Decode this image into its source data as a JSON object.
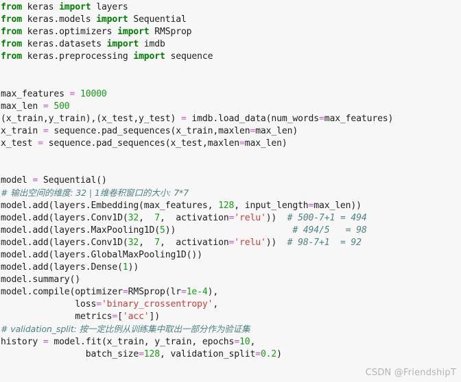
{
  "editor": {
    "background_color": "#f7f7f7",
    "default_text_color": "#202020",
    "syntax_colors": {
      "keyword": "#008000",
      "number": "#14a014",
      "string": "#d13b3b",
      "operator": "#cc55cc",
      "comment": "#4d8383"
    },
    "lines": [
      {
        "id": "l01",
        "tokens": [
          {
            "t": "from",
            "c": "kw"
          },
          {
            "t": " keras ",
            "c": "plain"
          },
          {
            "t": "import",
            "c": "kw"
          },
          {
            "t": " layers",
            "c": "plain"
          }
        ]
      },
      {
        "id": "l02",
        "tokens": [
          {
            "t": "from",
            "c": "kw"
          },
          {
            "t": " keras.models ",
            "c": "plain"
          },
          {
            "t": "import",
            "c": "kw"
          },
          {
            "t": " Sequential",
            "c": "plain"
          }
        ]
      },
      {
        "id": "l03",
        "tokens": [
          {
            "t": "from",
            "c": "kw"
          },
          {
            "t": " keras.optimizers ",
            "c": "plain"
          },
          {
            "t": "import",
            "c": "kw"
          },
          {
            "t": " RMSprop",
            "c": "plain"
          }
        ]
      },
      {
        "id": "l04",
        "tokens": [
          {
            "t": "from",
            "c": "kw"
          },
          {
            "t": " keras.datasets ",
            "c": "plain"
          },
          {
            "t": "import",
            "c": "kw"
          },
          {
            "t": " imdb",
            "c": "plain"
          }
        ]
      },
      {
        "id": "l05",
        "tokens": [
          {
            "t": "from",
            "c": "kw"
          },
          {
            "t": " keras.preprocessing ",
            "c": "plain"
          },
          {
            "t": "import",
            "c": "kw"
          },
          {
            "t": " sequence",
            "c": "plain"
          }
        ]
      },
      {
        "id": "l06",
        "tokens": []
      },
      {
        "id": "l07",
        "tokens": []
      },
      {
        "id": "l08",
        "tokens": [
          {
            "t": "max_features ",
            "c": "plain"
          },
          {
            "t": "=",
            "c": "op"
          },
          {
            "t": " ",
            "c": "plain"
          },
          {
            "t": "10000",
            "c": "num"
          }
        ]
      },
      {
        "id": "l09",
        "tokens": [
          {
            "t": "max_len ",
            "c": "plain"
          },
          {
            "t": "=",
            "c": "op"
          },
          {
            "t": " ",
            "c": "plain"
          },
          {
            "t": "500",
            "c": "num"
          }
        ]
      },
      {
        "id": "l10",
        "tokens": [
          {
            "t": "(x_train,y_train),(x_test,y_test) ",
            "c": "plain"
          },
          {
            "t": "=",
            "c": "op"
          },
          {
            "t": " imdb.load_data(num_words",
            "c": "plain"
          },
          {
            "t": "=",
            "c": "op"
          },
          {
            "t": "max_features)",
            "c": "plain"
          }
        ]
      },
      {
        "id": "l11",
        "tokens": [
          {
            "t": "x_train ",
            "c": "plain"
          },
          {
            "t": "=",
            "c": "op"
          },
          {
            "t": " sequence.pad_sequences(x_train,maxlen",
            "c": "plain"
          },
          {
            "t": "=",
            "c": "op"
          },
          {
            "t": "max_len)",
            "c": "plain"
          }
        ]
      },
      {
        "id": "l12",
        "tokens": [
          {
            "t": "x_test ",
            "c": "plain"
          },
          {
            "t": "=",
            "c": "op"
          },
          {
            "t": " sequence.pad_sequences(x_test,maxlen",
            "c": "plain"
          },
          {
            "t": "=",
            "c": "op"
          },
          {
            "t": "max_len)",
            "c": "plain"
          }
        ]
      },
      {
        "id": "l13",
        "tokens": []
      },
      {
        "id": "l14",
        "tokens": []
      },
      {
        "id": "l15",
        "tokens": [
          {
            "t": "model ",
            "c": "plain"
          },
          {
            "t": "=",
            "c": "op"
          },
          {
            "t": " Sequential()",
            "c": "plain"
          }
        ]
      },
      {
        "id": "l16",
        "tokens": [
          {
            "t": "# 输出空间的维度: 32 | 1维卷积窗口的大小: 7*7",
            "c": "cmt-cjk"
          }
        ]
      },
      {
        "id": "l17",
        "tokens": [
          {
            "t": "model.add(layers.Embedding(max_features, ",
            "c": "plain"
          },
          {
            "t": "128",
            "c": "num"
          },
          {
            "t": ", input_length",
            "c": "plain"
          },
          {
            "t": "=",
            "c": "op"
          },
          {
            "t": "max_len))",
            "c": "plain"
          }
        ]
      },
      {
        "id": "l18",
        "tokens": [
          {
            "t": "model.add(layers.Conv1D(",
            "c": "plain"
          },
          {
            "t": "32",
            "c": "num"
          },
          {
            "t": ",  ",
            "c": "plain"
          },
          {
            "t": "7",
            "c": "num"
          },
          {
            "t": ",  activation",
            "c": "plain"
          },
          {
            "t": "=",
            "c": "op"
          },
          {
            "t": "'relu'",
            "c": "str"
          },
          {
            "t": "))  ",
            "c": "plain"
          },
          {
            "t": "# 500-7+1 = 494",
            "c": "cmt"
          }
        ]
      },
      {
        "id": "l19",
        "tokens": [
          {
            "t": "model.add(layers.MaxPooling1D(",
            "c": "plain"
          },
          {
            "t": "5",
            "c": "num"
          },
          {
            "t": "))                      ",
            "c": "plain"
          },
          {
            "t": "# 494/5   = 98",
            "c": "cmt"
          }
        ]
      },
      {
        "id": "l20",
        "tokens": [
          {
            "t": "model.add(layers.Conv1D(",
            "c": "plain"
          },
          {
            "t": "32",
            "c": "num"
          },
          {
            "t": ",  ",
            "c": "plain"
          },
          {
            "t": "7",
            "c": "num"
          },
          {
            "t": ",  activation",
            "c": "plain"
          },
          {
            "t": "=",
            "c": "op"
          },
          {
            "t": "'relu'",
            "c": "str"
          },
          {
            "t": "))  ",
            "c": "plain"
          },
          {
            "t": "# 98-7+1  = 92",
            "c": "cmt"
          }
        ]
      },
      {
        "id": "l21",
        "tokens": [
          {
            "t": "model.add(layers.GlobalMaxPooling1D())",
            "c": "plain"
          }
        ]
      },
      {
        "id": "l22",
        "tokens": [
          {
            "t": "model.add(layers.Dense(",
            "c": "plain"
          },
          {
            "t": "1",
            "c": "num"
          },
          {
            "t": "))",
            "c": "plain"
          }
        ]
      },
      {
        "id": "l23",
        "tokens": [
          {
            "t": "model.summary()",
            "c": "plain"
          }
        ]
      },
      {
        "id": "l24",
        "tokens": [
          {
            "t": "model.compile(optimizer",
            "c": "plain"
          },
          {
            "t": "=",
            "c": "op"
          },
          {
            "t": "RMSprop(lr",
            "c": "plain"
          },
          {
            "t": "=",
            "c": "op"
          },
          {
            "t": "1e-4",
            "c": "num"
          },
          {
            "t": "),",
            "c": "plain"
          }
        ]
      },
      {
        "id": "l25",
        "tokens": [
          {
            "t": "              loss",
            "c": "plain"
          },
          {
            "t": "=",
            "c": "op"
          },
          {
            "t": "'binary_crossentropy'",
            "c": "str"
          },
          {
            "t": ",",
            "c": "plain"
          }
        ]
      },
      {
        "id": "l26",
        "tokens": [
          {
            "t": "              metrics",
            "c": "plain"
          },
          {
            "t": "=",
            "c": "op"
          },
          {
            "t": "[",
            "c": "plain"
          },
          {
            "t": "'acc'",
            "c": "str"
          },
          {
            "t": "])",
            "c": "plain"
          }
        ]
      },
      {
        "id": "l27",
        "tokens": [
          {
            "t": "# validation_split: 按一定比例从训练集中取出一部分作为验证集",
            "c": "cmt-cjk"
          }
        ]
      },
      {
        "id": "l28",
        "tokens": [
          {
            "t": "history ",
            "c": "plain"
          },
          {
            "t": "=",
            "c": "op"
          },
          {
            "t": " model.fit(x_train, y_train, epochs",
            "c": "plain"
          },
          {
            "t": "=",
            "c": "op"
          },
          {
            "t": "10",
            "c": "num"
          },
          {
            "t": ",",
            "c": "plain"
          }
        ]
      },
      {
        "id": "l29",
        "tokens": [
          {
            "t": "                batch_size",
            "c": "plain"
          },
          {
            "t": "=",
            "c": "op"
          },
          {
            "t": "128",
            "c": "num"
          },
          {
            "t": ", validation_split",
            "c": "plain"
          },
          {
            "t": "=",
            "c": "op"
          },
          {
            "t": "0.2",
            "c": "num"
          },
          {
            "t": ")",
            "c": "plain"
          }
        ]
      }
    ]
  },
  "watermark": {
    "text": "CSDN @FriendshipT",
    "color": "#b4b4b4"
  }
}
